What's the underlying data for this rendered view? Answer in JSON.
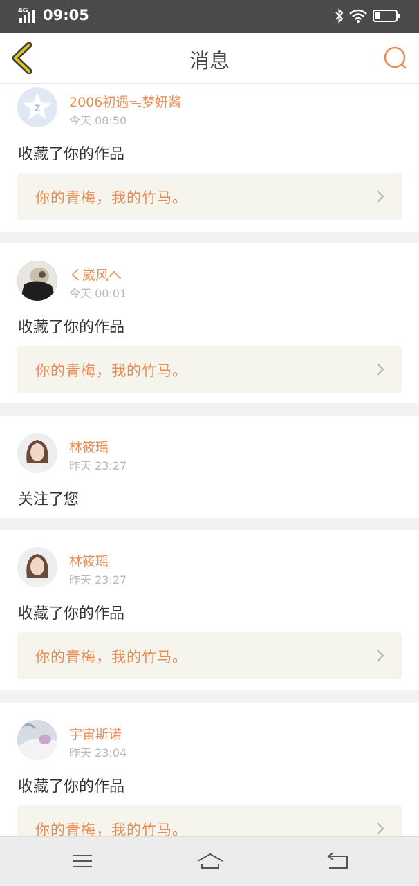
{
  "status_bar": {
    "network": "4G",
    "time": "09:05",
    "icons": [
      "signal-icon",
      "bluetooth-icon",
      "wifi-icon",
      "battery-icon"
    ]
  },
  "header": {
    "title": "消息",
    "back_icon": "chevron-left-icon",
    "search_icon": "search-icon"
  },
  "colors": {
    "accent": "#e88d54",
    "back_icon": "#c9b21b",
    "work_box_bg": "#f5f5ee",
    "status_bar_bg": "#4a4a4a"
  },
  "messages": [
    {
      "user": "2006初遇ᯓ梦妍酱",
      "time": "今天 08:50",
      "action": "收藏了你的作品",
      "work": "你的青梅，我的竹马。",
      "avatar": "qzone-logo"
    },
    {
      "user": "く崴风へ",
      "time": "今天 00:01",
      "action": "收藏了你的作品",
      "work": "你的青梅，我的竹马。",
      "avatar": "user-photo"
    },
    {
      "user": "林筱瑶",
      "time": "昨天 23:27",
      "action": "关注了您",
      "avatar": "user-photo"
    },
    {
      "user": "林筱瑶",
      "time": "昨天 23:27",
      "action": "收藏了你的作品",
      "work": "你的青梅，我的竹马。",
      "avatar": "user-photo"
    },
    {
      "user": "宇宙斯诺",
      "time": "昨天 23:04",
      "action": "收藏了你的作品",
      "work": "你的青梅，我的竹马。",
      "avatar": "user-photo"
    }
  ],
  "nav_bar": [
    "menu-icon",
    "home-icon",
    "back-icon"
  ]
}
